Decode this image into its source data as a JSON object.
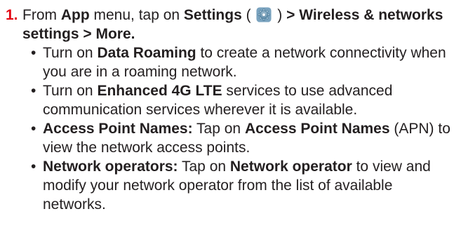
{
  "step": {
    "number": "1.",
    "intro_prefix": "From ",
    "app": "App",
    "menu_tap": " menu, tap on ",
    "settings": "Settings",
    "paren_open": " ( ",
    "paren_close": " )",
    "path": " > Wireless & networks settings > More."
  },
  "bullets": [
    {
      "bold_lead": "",
      "pre": "Turn on ",
      "bold": "Data Roaming",
      "post": " to create a network connectivity when you are in a roaming network."
    },
    {
      "bold_lead": "",
      "pre": "Turn on ",
      "bold": "Enhanced 4G LTE",
      "post": " services to use advanced communication services wherever it is available."
    },
    {
      "bold_lead": "Access Point Names:",
      "pre": " Tap on ",
      "bold": "Access Point Names",
      "post": " (APN) to view the network access points."
    },
    {
      "bold_lead": "Network operators:",
      "pre": " Tap on ",
      "bold": "Network operator",
      "post": " to view and modify your network operator from the list of available networks."
    }
  ],
  "bullet_char": "•",
  "colors": {
    "step_number": "#e30613",
    "text": "#231f20",
    "gear_fill": "#5b8fb0"
  },
  "icons": {
    "settings": "gear-icon"
  }
}
